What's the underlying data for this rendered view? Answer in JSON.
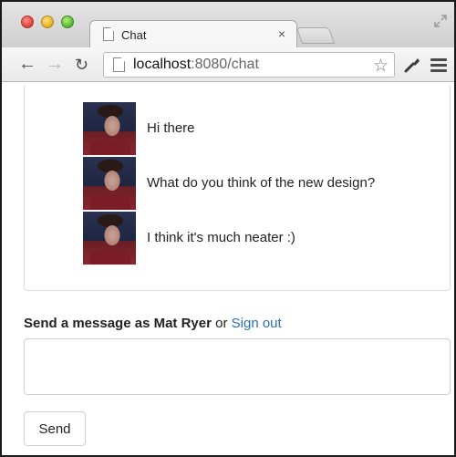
{
  "browser": {
    "tab_title": "Chat",
    "tab_close": "×",
    "url_host": "localhost",
    "url_rest": ":8080/chat"
  },
  "icons": {
    "back": "arrow-left-icon",
    "forward": "arrow-right-icon",
    "reload": "reload-icon",
    "star": "star-icon",
    "wrench": "wrench-icon",
    "menu": "menu-icon"
  },
  "messages": [
    {
      "text": "Hi there"
    },
    {
      "text": "What do you think of the new design?"
    },
    {
      "text": "I think it's much neater :)"
    }
  ],
  "compose": {
    "prefix": "Send a message as ",
    "user_name": "Mat Ryer",
    "connector": " or ",
    "sign_out": "Sign out",
    "input_value": "",
    "send_label": "Send"
  }
}
